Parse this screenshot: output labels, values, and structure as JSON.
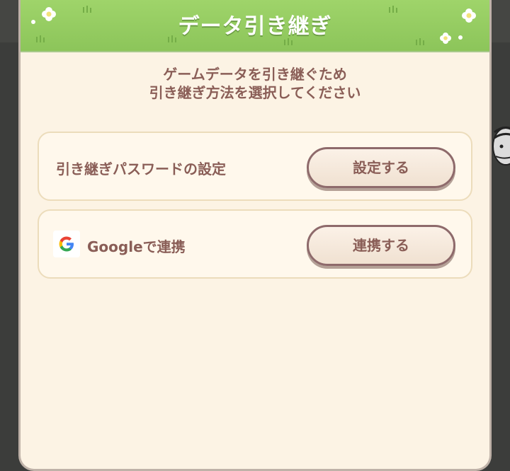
{
  "dialog": {
    "title": "データ引き継ぎ",
    "instruction_line1": "ゲームデータを引き継ぐため",
    "instruction_line2": "引き継ぎ方法を選択してください"
  },
  "options": [
    {
      "label": "引き継ぎパスワードの設定",
      "button_label": "設定する"
    },
    {
      "label": "Googleで連携",
      "icon": "google-logo-icon",
      "button_label": "連携する"
    }
  ],
  "colors": {
    "header_green": "#8cc55a",
    "panel_bg": "#fcf3e4",
    "text_brown": "#8a5e57",
    "button_border": "#8e6a6b"
  }
}
